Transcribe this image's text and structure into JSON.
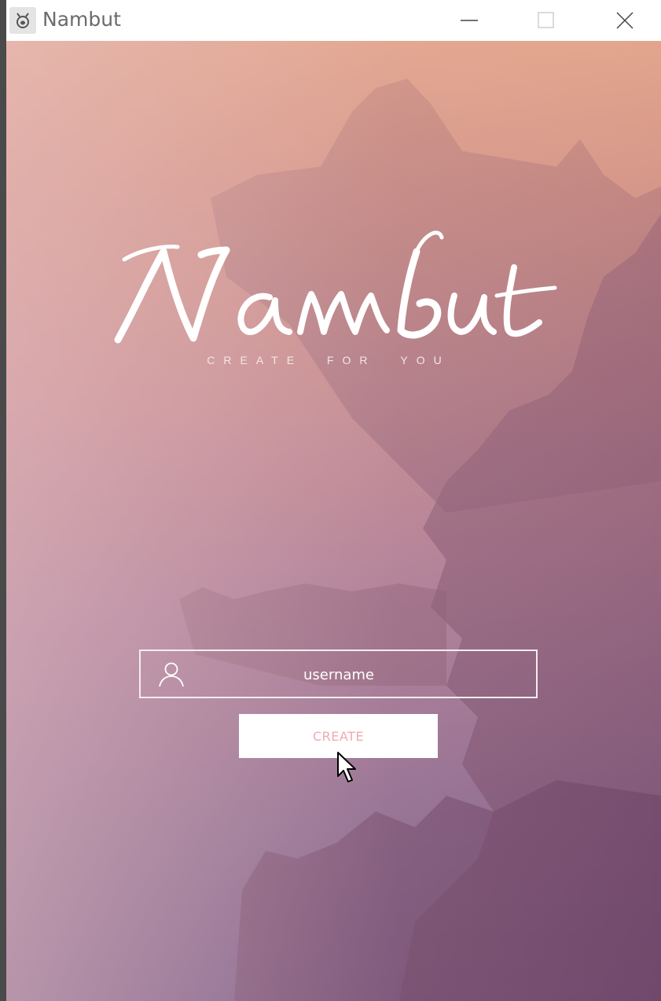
{
  "window": {
    "title": "Nambut",
    "controls": [
      "minimize-icon",
      "maximize-icon",
      "close-icon"
    ]
  },
  "brand": {
    "logo_text": "Nambut",
    "tagline": [
      "CREATE",
      "FOR",
      "YOU"
    ]
  },
  "form": {
    "username_placeholder": "username",
    "username_value": "",
    "create_label": "CREATE"
  },
  "colors": {
    "accent": "#f2a9b3",
    "sky_top": "#e2a58c",
    "sky_bottom": "#7a5c88"
  }
}
